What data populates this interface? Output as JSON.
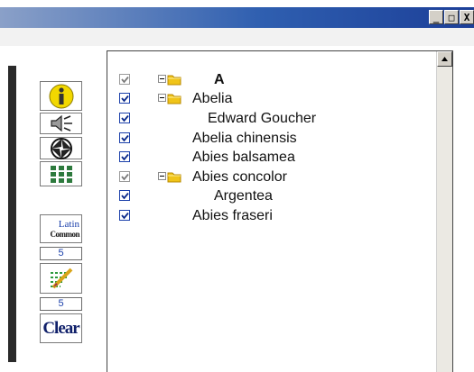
{
  "titlebar": {
    "minimize": "_",
    "maximize": "□",
    "close": "X"
  },
  "tools": {
    "latin_label": "Latin",
    "common_label": "Common",
    "number_top": "5",
    "number_bottom": "5",
    "clear_label": "Clear"
  },
  "tree": [
    {
      "label": "A",
      "checked": true,
      "check_style": "gray",
      "expandable": true,
      "folder": true,
      "bold": true
    },
    {
      "label": "Abelia",
      "checked": true,
      "check_style": "blue",
      "expandable": true,
      "folder": true
    },
    {
      "label": "Edward Goucher",
      "checked": true,
      "check_style": "blue"
    },
    {
      "label": "Abelia chinensis",
      "checked": true,
      "check_style": "blue"
    },
    {
      "label": "Abies balsamea",
      "checked": true,
      "check_style": "blue"
    },
    {
      "label": "Abies concolor",
      "checked": true,
      "check_style": "gray",
      "expandable": true,
      "folder": true
    },
    {
      "label": "Argentea",
      "checked": true,
      "check_style": "blue"
    },
    {
      "label": "Abies fraseri",
      "checked": true,
      "check_style": "blue"
    }
  ]
}
